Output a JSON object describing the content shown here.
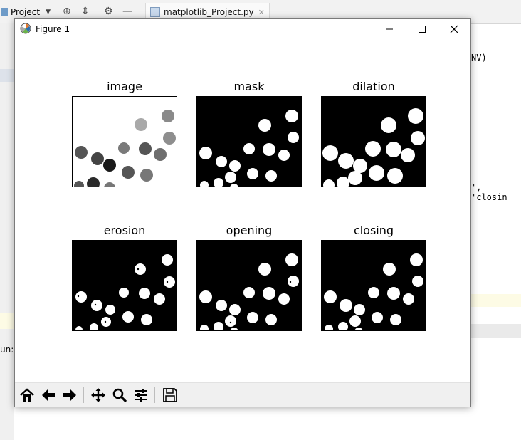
{
  "ide": {
    "project_label": "Project",
    "file_tab": "matplotlib_Project.py",
    "code_fragment_1": "NV)",
    "code_fragment_2": "', 'closin",
    "run_label": "un:"
  },
  "figure": {
    "title": "Figure 1",
    "subplots": [
      {
        "title": "image"
      },
      {
        "title": "mask"
      },
      {
        "title": "dilation"
      },
      {
        "title": "erosion"
      },
      {
        "title": "opening"
      },
      {
        "title": "closing"
      }
    ]
  },
  "toolbar_icons": [
    "home-icon",
    "back-arrow-icon",
    "forward-arrow-icon",
    "pan-icon",
    "zoom-icon",
    "configure-subplots-icon",
    "save-icon"
  ],
  "colors": {
    "mask_background": "#000000",
    "mask_foreground": "#ffffff",
    "toolbar_background": "#f0f0f0"
  }
}
